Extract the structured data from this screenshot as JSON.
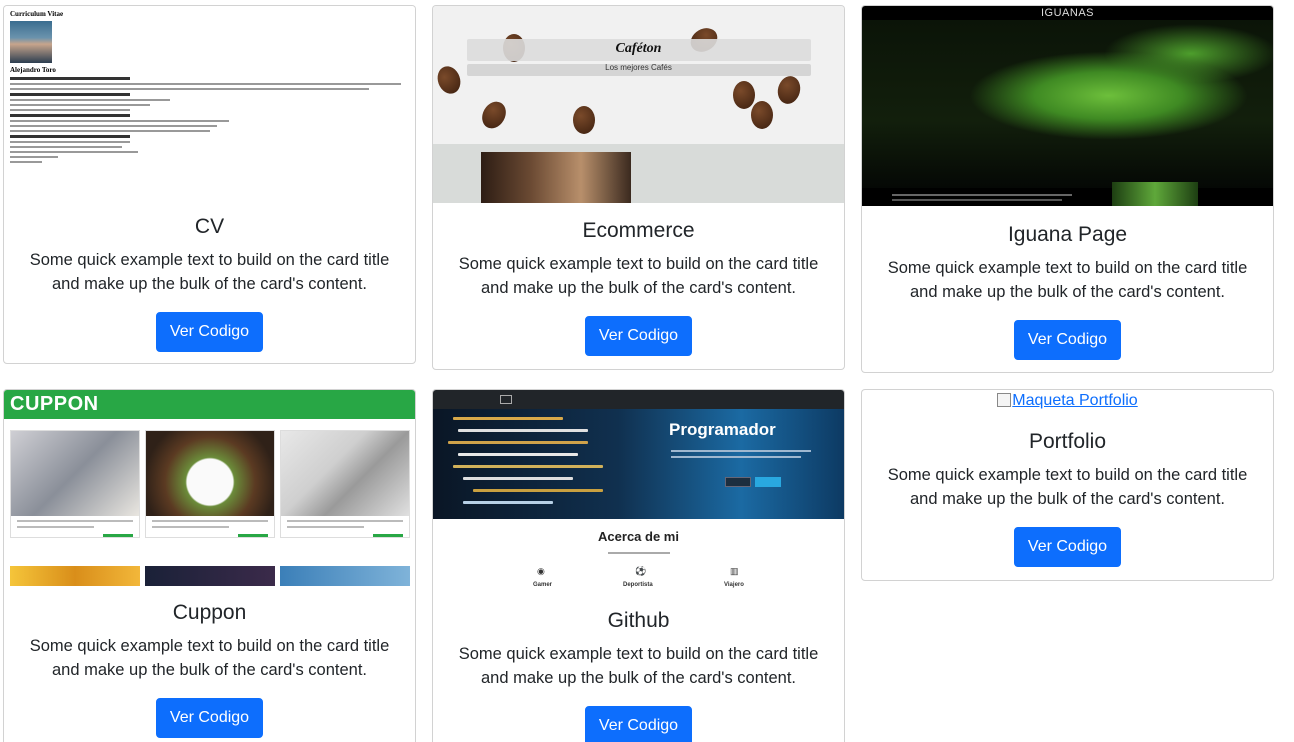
{
  "cards": [
    {
      "title": "CV",
      "text": "Some quick example text to build on the card title and make up the bulk of the card's content.",
      "button": "Ver Codigo",
      "thumb": {
        "heading": "Curriculum Vitae",
        "name": "Alejandro Toro"
      }
    },
    {
      "title": "Ecommerce",
      "text": "Some quick example text to build on the card title and make up the bulk of the card's content.",
      "button": "Ver Codigo",
      "thumb": {
        "brand": "Caféton",
        "tagline": "Los mejores Cafés"
      }
    },
    {
      "title": "Iguana Page",
      "text": "Some quick example text to build on the card title and make up the bulk of the card's content.",
      "button": "Ver Codigo",
      "thumb": {
        "heading": "IGUANAS"
      }
    },
    {
      "title": "Cuppon",
      "text": "Some quick example text to build on the card title and make up the bulk of the card's content.",
      "button": "Ver Codigo",
      "thumb": {
        "logo": "CUPPON"
      }
    },
    {
      "title": "Github",
      "text": "Some quick example text to build on the card title and make up the bulk of the card's content.",
      "button": "Ver Codigo",
      "thumb": {
        "hero": "Programador",
        "about": "Acerca de mi",
        "items": [
          "Gamer",
          "Deportista",
          "Viajero"
        ]
      }
    },
    {
      "title": "Portfolio",
      "text": "Some quick example text to build on the card title and make up the bulk of the card's content.",
      "button": "Ver Codigo",
      "image_alt": "Maqueta Portfolio"
    }
  ],
  "colors": {
    "primary": "#0d6efd",
    "cuppon_green": "#28a745"
  }
}
